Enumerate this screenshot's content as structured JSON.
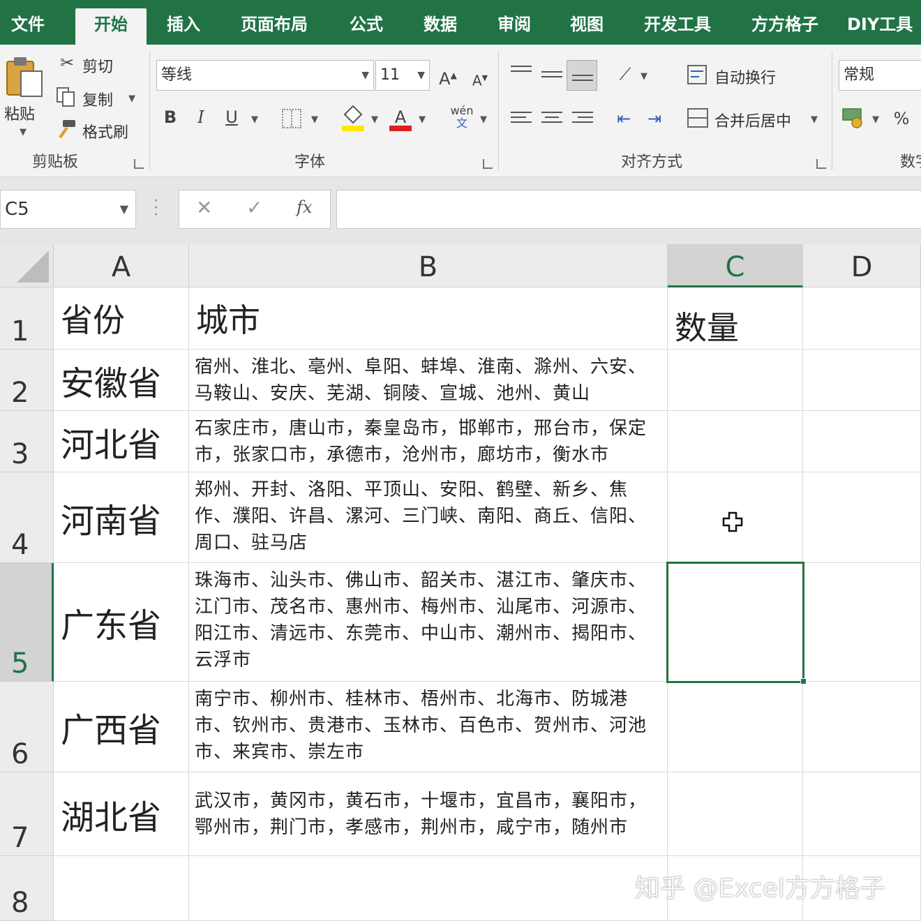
{
  "ribbon_tabs": [
    "文件",
    "开始",
    "插入",
    "页面布局",
    "公式",
    "数据",
    "审阅",
    "视图",
    "开发工具",
    "方方格子",
    "DIY工具"
  ],
  "active_tab": "开始",
  "clipboard": {
    "paste_label": "粘贴",
    "cut_label": "剪切",
    "copy_label": "复制",
    "format_painter_label": "格式刷",
    "group_label": "剪贴板"
  },
  "font": {
    "font_name": "等线",
    "font_size": "11",
    "grow_label": "A",
    "shrink_label": "A",
    "bold_label": "B",
    "italic_label": "I",
    "underline_label": "U",
    "font_color_label": "A",
    "phonetic_label": "wén",
    "phonetic_sub": "文",
    "group_label": "字体",
    "fill_color": "#ffe600",
    "font_color": "#e02020"
  },
  "alignment": {
    "wrap_text_label": "自动换行",
    "merge_center_label": "合并后居中",
    "group_label": "对齐方式"
  },
  "number": {
    "format": "常规",
    "percent_label": "%",
    "group_label": "数字"
  },
  "formula_bar": {
    "name_box": "C5",
    "cancel_glyph": "✕",
    "enter_glyph": "✓",
    "fx_label": "fx",
    "formula": ""
  },
  "sheet": {
    "columns": [
      "A",
      "B",
      "C",
      "D"
    ],
    "rows": [
      "1",
      "2",
      "3",
      "4",
      "5",
      "6",
      "7",
      "8"
    ],
    "selected_cell": "C5",
    "header_row": {
      "a": "省份",
      "b": "城市",
      "c": "数量"
    },
    "data": [
      {
        "province": "安徽省",
        "cities": "宿州、淮北、亳州、阜阳、蚌埠、淮南、滁州、六安、马鞍山、安庆、芜湖、铜陵、宣城、池州、黄山"
      },
      {
        "province": "河北省",
        "cities": "石家庄市，唐山市，秦皇岛市，邯郸市，邢台市，保定市，张家口市，承德市，沧州市，廊坊市，衡水市"
      },
      {
        "province": "河南省",
        "cities": "郑州、开封、洛阳、平顶山、安阳、鹤壁、新乡、焦作、濮阳、许昌、漯河、三门峡、南阳、商丘、信阳、周口、驻马店"
      },
      {
        "province": "广东省",
        "cities": "珠海市、汕头市、佛山市、韶关市、湛江市、肇庆市、江门市、茂名市、惠州市、梅州市、汕尾市、河源市、阳江市、清远市、东莞市、中山市、潮州市、揭阳市、云浮市"
      },
      {
        "province": "广西省",
        "cities": "南宁市、柳州市、桂林市、梧州市、北海市、防城港市、钦州市、贵港市、玉林市、百色市、贺州市、河池市、来宾市、崇左市"
      },
      {
        "province": "湖北省",
        "cities": "武汉市，黄冈市，黄石市，十堰市，宜昌市，襄阳市，鄂州市，荆门市，孝感市，荆州市，咸宁市，随州市"
      }
    ]
  },
  "watermark": "知乎 @Excel方方格子",
  "colors": {
    "excel_green": "#217346"
  }
}
